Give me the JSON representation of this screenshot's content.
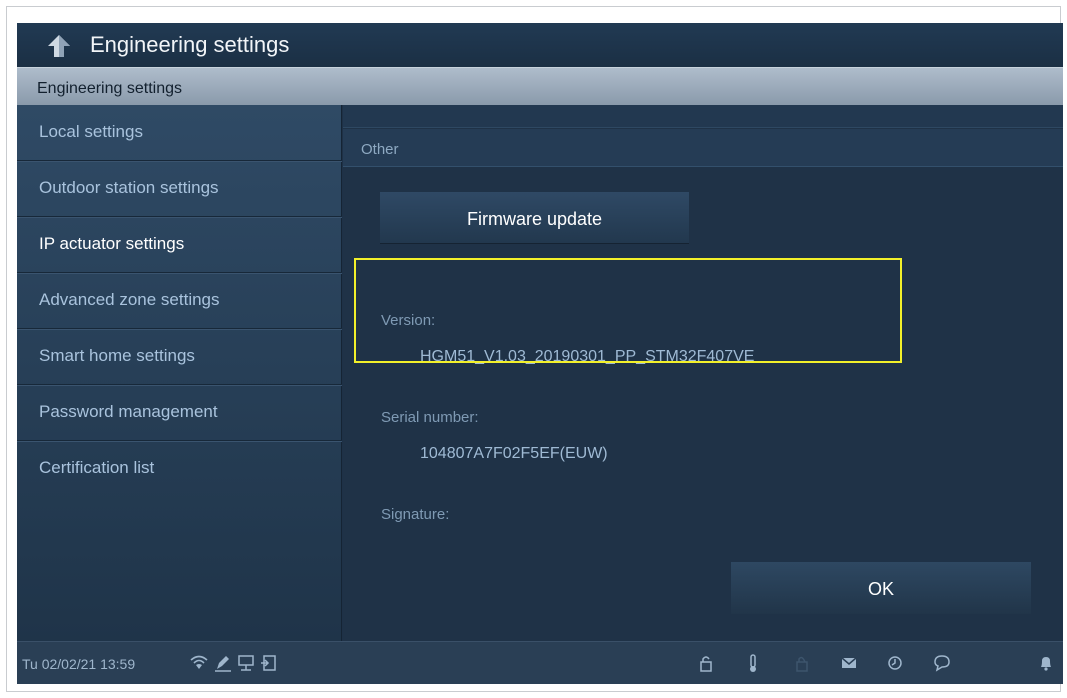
{
  "titlebar": {
    "title": "Engineering settings",
    "back_icon": "back-arrow-icon"
  },
  "section_header": "Engineering settings",
  "sidebar": {
    "items": [
      {
        "label": "Local settings",
        "active": false
      },
      {
        "label": "Outdoor station settings",
        "active": false
      },
      {
        "label": "IP actuator settings",
        "active": true
      },
      {
        "label": "Advanced zone settings",
        "active": false
      },
      {
        "label": "Smart home settings",
        "active": false
      },
      {
        "label": "Password management",
        "active": false
      },
      {
        "label": "Certification list",
        "active": false
      }
    ]
  },
  "content": {
    "subheader": "Other",
    "firmware_button": "Firmware update",
    "version_label": "Version:",
    "version_value": "HGM51_V1.03_20190301_PP_STM32F407VE",
    "serial_label": "Serial number:",
    "serial_value": "104807A7F02F5EF(EUW)",
    "signature_label": "Signature:",
    "ok_button": "OK"
  },
  "statusbar": {
    "datetime": "Tu 02/02/21  13:59",
    "left_icons": [
      "wifi-icon",
      "edit-icon",
      "network-icon",
      "door-icon"
    ],
    "right_icons": [
      "lock-icon",
      "thermometer-icon",
      "lock-closed-icon",
      "mail-icon",
      "history-icon",
      "chat-icon",
      "bell-icon"
    ]
  },
  "colors": {
    "background": "#1e3147",
    "accent_highlight": "#f2f02a",
    "text_primary": "#ffffff",
    "text_secondary": "#a9c3dd"
  }
}
